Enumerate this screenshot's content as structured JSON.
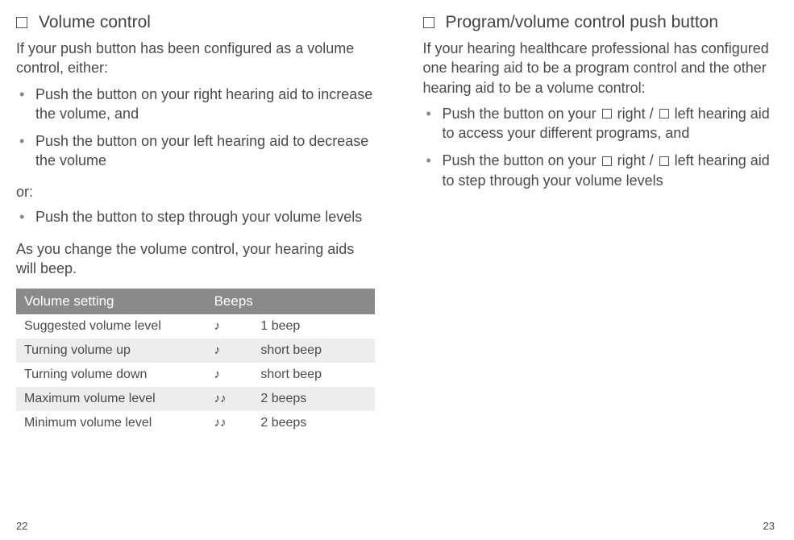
{
  "left": {
    "heading": "Volume control",
    "intro": "If your push button has been configured as a volume control, either:",
    "bullets1": [
      "Push the button on your right hearing aid to increase the volume, and",
      "Push the button on your left hearing aid to decrease the volume"
    ],
    "or": "or:",
    "bullets2": [
      "Push the button to step through your volume levels"
    ],
    "outro": "As you change the volume control, your hearing aids will beep.",
    "table": {
      "headers": {
        "col1": "Volume setting",
        "col2": "Beeps"
      },
      "rows": [
        {
          "setting": "Suggested volume level",
          "icon": "♪",
          "beeps": "1 beep"
        },
        {
          "setting": "Turning volume up",
          "icon": "♪",
          "beeps": "short beep"
        },
        {
          "setting": "Turning volume down",
          "icon": "♪",
          "beeps": "short beep"
        },
        {
          "setting": "Maximum volume level",
          "icon": "♪♪",
          "beeps": "2 beeps"
        },
        {
          "setting": "Minimum volume level",
          "icon": "♪♪",
          "beeps": "2 beeps"
        }
      ]
    },
    "pageNum": "22"
  },
  "right": {
    "heading": "Program/volume control push button",
    "intro": "If your hearing healthcare professional has configured one hearing aid to be a program control and the other hearing aid to be a volume control:",
    "bullet1_pre": "Push the button on your ",
    "bullet1_r": " right / ",
    "bullet1_l": " left hearing aid to access your different programs, and",
    "bullet2_pre": "Push the button on your ",
    "bullet2_r": " right / ",
    "bullet2_l": " left hearing aid to step through your volume levels",
    "pageNum": "23"
  }
}
